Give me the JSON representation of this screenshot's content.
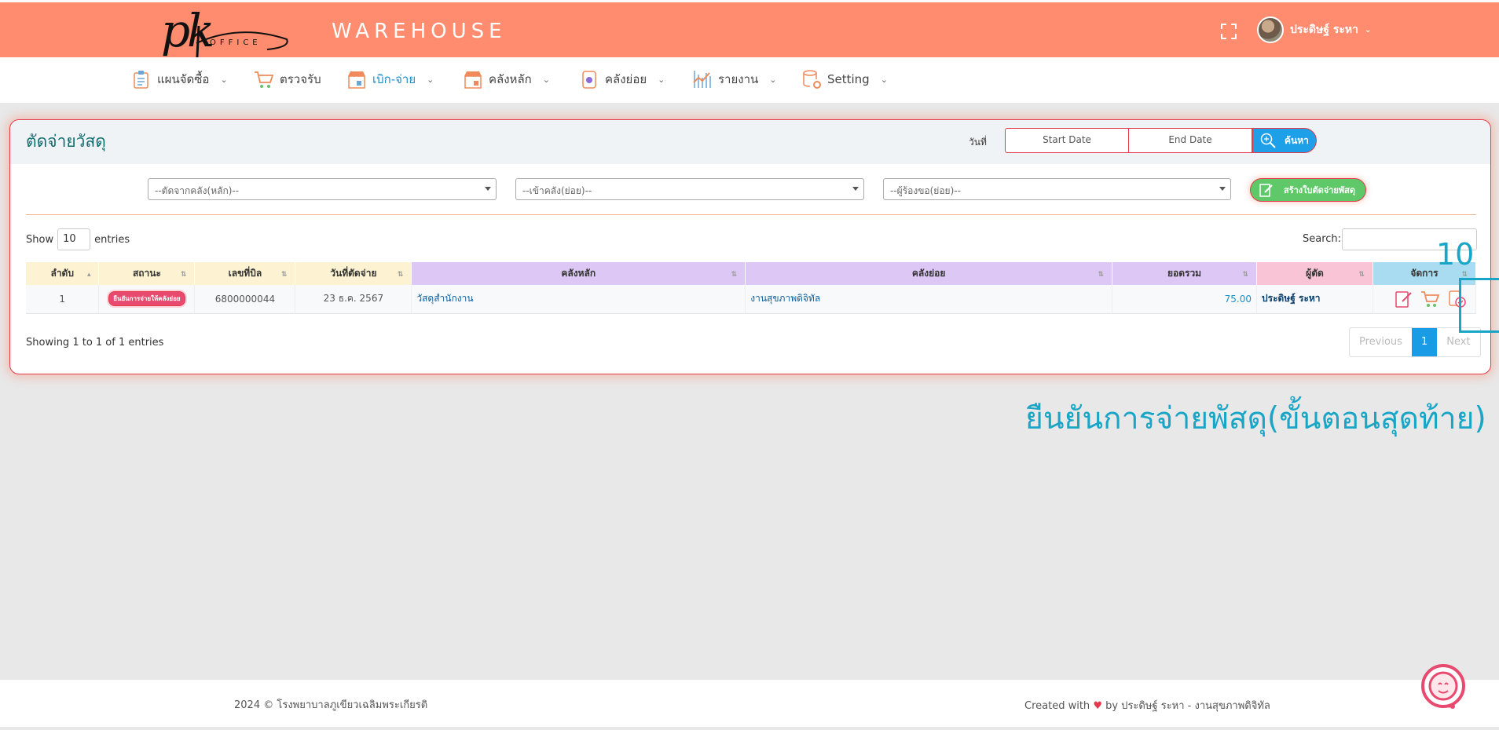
{
  "header": {
    "logo_text": "pk",
    "logo_sub": "OFFICE",
    "brand": "WAREHOUSE",
    "user_name": "ประดิษฐ์ ระหา"
  },
  "nav": [
    {
      "label": "แผนจัดซื้อ",
      "icon": "clipboard-icon"
    },
    {
      "label": "ตรวจรับ",
      "icon": "cart-icon"
    },
    {
      "label": "เบิก-จ่าย",
      "icon": "store-icon"
    },
    {
      "label": "คลังหลัก",
      "icon": "warehouse-icon"
    },
    {
      "label": "คลังย่อย",
      "icon": "box-icon"
    },
    {
      "label": "รายงาน",
      "icon": "chart-icon"
    },
    {
      "label": "Setting",
      "icon": "database-gear-icon"
    }
  ],
  "card": {
    "title": "ตัดจ่ายวัสดุ",
    "date_label": "วันที่",
    "start_date_placeholder": "Start Date",
    "end_date_placeholder": "End Date",
    "search_button": "ค้นหา",
    "filters": [
      "--ตัดจากคลัง(หลัก)--",
      "--เข้าคลัง(ย่อย)--",
      "--ผู้ร้องขอ(ย่อย)--"
    ],
    "create_button": "สร้างใบตัดจ่ายพัสดุ"
  },
  "table_controls": {
    "show_label": "Show",
    "entries_value": "10",
    "entries_label": "entries",
    "search_label": "Search:"
  },
  "table": {
    "columns": [
      "ลำดับ",
      "สถานะ",
      "เลขที่บิล",
      "วันที่ตัดจ่าย",
      "คลังหลัก",
      "คลังย่อย",
      "ยอดรวม",
      "ผู้ตัด",
      "จัดการ"
    ],
    "header_colors": [
      "#fdf3d2",
      "#fdf3d2",
      "#fdf3d2",
      "#fdf3d2",
      "#ddc8f5",
      "#ddc8f5",
      "#ddc8f5",
      "#f8c4d6",
      "#a9dcf0"
    ],
    "rows": [
      {
        "index": "1",
        "status": "ยืนยันการจ่ายให้คลังย่อย",
        "bill_no": "6800000044",
        "date": "23 ธ.ค. 2567",
        "main_store": "วัสดุสำนักงาน",
        "sub_store": "งานสุขภาพดิจิทัล",
        "total": "75.00",
        "cutter": "ประดิษฐ์ ระหา"
      }
    ]
  },
  "pagination": {
    "showing": "Showing 1 to 1 of 1 entries",
    "previous": "Previous",
    "current": "1",
    "next": "Next"
  },
  "annotation": {
    "step_number": "10",
    "caption": "ยืนยันการจ่ายพัสดุ(ขั้นตอนสุดท้าย)"
  },
  "footer": {
    "left": "2024 © โรงพยาบาลภูเขียวเฉลิมพระเกียรติ",
    "right_prefix": "Created with",
    "right_suffix": "by ประดิษฐ์ ระหา - งานสุขภาพดิจิทัล"
  }
}
